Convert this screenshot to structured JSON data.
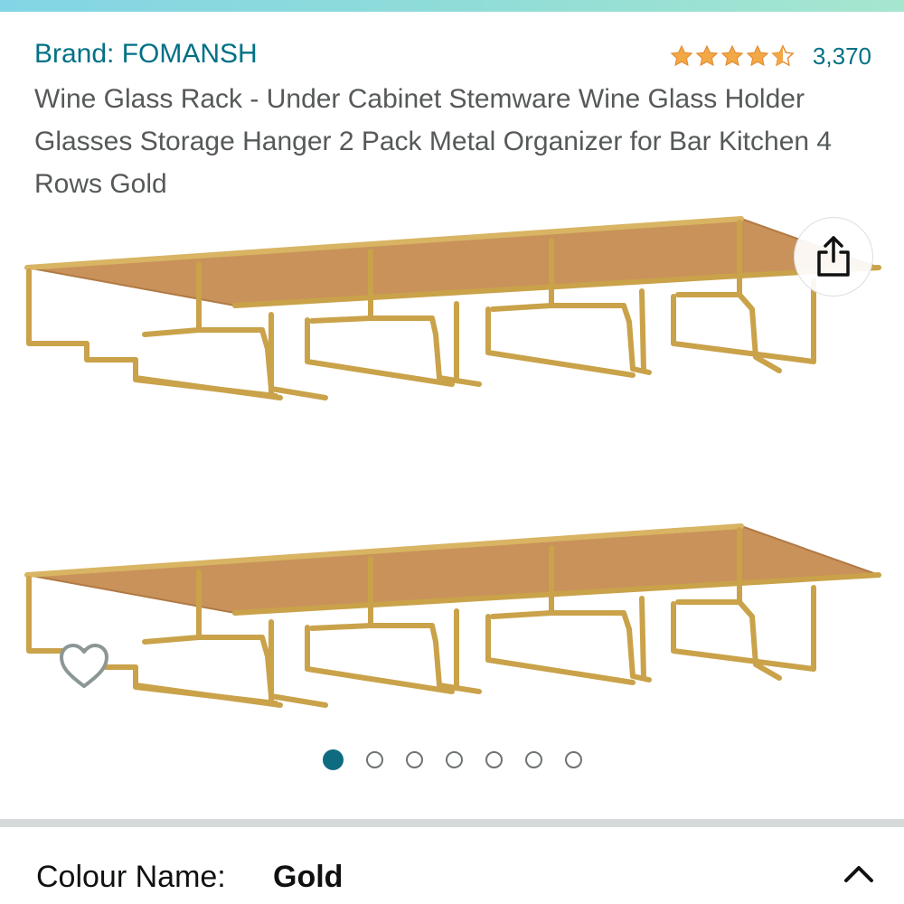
{
  "header": {
    "brand_link": "Brand: FOMANSH",
    "rating": 4.5,
    "rating_count": "3,370",
    "accent": "#007185",
    "star_color": "#f3a847"
  },
  "product": {
    "title": "Wine Glass Rack - Under Cabinet Stemware Wine Glass Holder Glasses Storage Hanger 2 Pack Metal Organizer for Bar Kitchen 4 Rows Gold"
  },
  "gallery": {
    "image_count": 7,
    "active_index": 1,
    "icons": {
      "share": "share-icon",
      "wishlist": "heart-icon"
    }
  },
  "variation": {
    "label": "Colour Name:",
    "value": "Gold",
    "toggle_icon": "chevron-up-icon"
  }
}
